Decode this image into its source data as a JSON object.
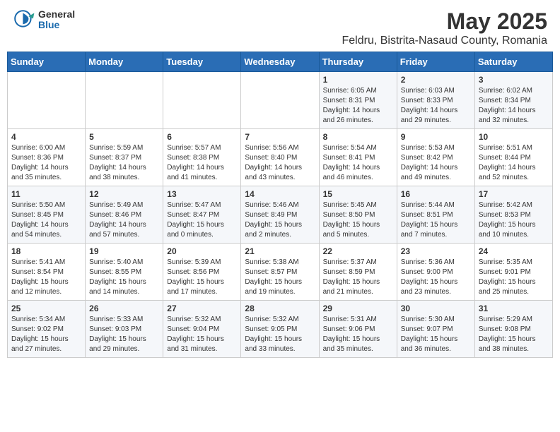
{
  "header": {
    "logo_general": "General",
    "logo_blue": "Blue",
    "title": "May 2025",
    "subtitle": "Feldru, Bistrita-Nasaud County, Romania"
  },
  "weekdays": [
    "Sunday",
    "Monday",
    "Tuesday",
    "Wednesday",
    "Thursday",
    "Friday",
    "Saturday"
  ],
  "weeks": [
    [
      {
        "day": "",
        "info": ""
      },
      {
        "day": "",
        "info": ""
      },
      {
        "day": "",
        "info": ""
      },
      {
        "day": "",
        "info": ""
      },
      {
        "day": "1",
        "info": "Sunrise: 6:05 AM\nSunset: 8:31 PM\nDaylight: 14 hours and 26 minutes."
      },
      {
        "day": "2",
        "info": "Sunrise: 6:03 AM\nSunset: 8:33 PM\nDaylight: 14 hours and 29 minutes."
      },
      {
        "day": "3",
        "info": "Sunrise: 6:02 AM\nSunset: 8:34 PM\nDaylight: 14 hours and 32 minutes."
      }
    ],
    [
      {
        "day": "4",
        "info": "Sunrise: 6:00 AM\nSunset: 8:36 PM\nDaylight: 14 hours and 35 minutes."
      },
      {
        "day": "5",
        "info": "Sunrise: 5:59 AM\nSunset: 8:37 PM\nDaylight: 14 hours and 38 minutes."
      },
      {
        "day": "6",
        "info": "Sunrise: 5:57 AM\nSunset: 8:38 PM\nDaylight: 14 hours and 41 minutes."
      },
      {
        "day": "7",
        "info": "Sunrise: 5:56 AM\nSunset: 8:40 PM\nDaylight: 14 hours and 43 minutes."
      },
      {
        "day": "8",
        "info": "Sunrise: 5:54 AM\nSunset: 8:41 PM\nDaylight: 14 hours and 46 minutes."
      },
      {
        "day": "9",
        "info": "Sunrise: 5:53 AM\nSunset: 8:42 PM\nDaylight: 14 hours and 49 minutes."
      },
      {
        "day": "10",
        "info": "Sunrise: 5:51 AM\nSunset: 8:44 PM\nDaylight: 14 hours and 52 minutes."
      }
    ],
    [
      {
        "day": "11",
        "info": "Sunrise: 5:50 AM\nSunset: 8:45 PM\nDaylight: 14 hours and 54 minutes."
      },
      {
        "day": "12",
        "info": "Sunrise: 5:49 AM\nSunset: 8:46 PM\nDaylight: 14 hours and 57 minutes."
      },
      {
        "day": "13",
        "info": "Sunrise: 5:47 AM\nSunset: 8:47 PM\nDaylight: 15 hours and 0 minutes."
      },
      {
        "day": "14",
        "info": "Sunrise: 5:46 AM\nSunset: 8:49 PM\nDaylight: 15 hours and 2 minutes."
      },
      {
        "day": "15",
        "info": "Sunrise: 5:45 AM\nSunset: 8:50 PM\nDaylight: 15 hours and 5 minutes."
      },
      {
        "day": "16",
        "info": "Sunrise: 5:44 AM\nSunset: 8:51 PM\nDaylight: 15 hours and 7 minutes."
      },
      {
        "day": "17",
        "info": "Sunrise: 5:42 AM\nSunset: 8:53 PM\nDaylight: 15 hours and 10 minutes."
      }
    ],
    [
      {
        "day": "18",
        "info": "Sunrise: 5:41 AM\nSunset: 8:54 PM\nDaylight: 15 hours and 12 minutes."
      },
      {
        "day": "19",
        "info": "Sunrise: 5:40 AM\nSunset: 8:55 PM\nDaylight: 15 hours and 14 minutes."
      },
      {
        "day": "20",
        "info": "Sunrise: 5:39 AM\nSunset: 8:56 PM\nDaylight: 15 hours and 17 minutes."
      },
      {
        "day": "21",
        "info": "Sunrise: 5:38 AM\nSunset: 8:57 PM\nDaylight: 15 hours and 19 minutes."
      },
      {
        "day": "22",
        "info": "Sunrise: 5:37 AM\nSunset: 8:59 PM\nDaylight: 15 hours and 21 minutes."
      },
      {
        "day": "23",
        "info": "Sunrise: 5:36 AM\nSunset: 9:00 PM\nDaylight: 15 hours and 23 minutes."
      },
      {
        "day": "24",
        "info": "Sunrise: 5:35 AM\nSunset: 9:01 PM\nDaylight: 15 hours and 25 minutes."
      }
    ],
    [
      {
        "day": "25",
        "info": "Sunrise: 5:34 AM\nSunset: 9:02 PM\nDaylight: 15 hours and 27 minutes."
      },
      {
        "day": "26",
        "info": "Sunrise: 5:33 AM\nSunset: 9:03 PM\nDaylight: 15 hours and 29 minutes."
      },
      {
        "day": "27",
        "info": "Sunrise: 5:32 AM\nSunset: 9:04 PM\nDaylight: 15 hours and 31 minutes."
      },
      {
        "day": "28",
        "info": "Sunrise: 5:32 AM\nSunset: 9:05 PM\nDaylight: 15 hours and 33 minutes."
      },
      {
        "day": "29",
        "info": "Sunrise: 5:31 AM\nSunset: 9:06 PM\nDaylight: 15 hours and 35 minutes."
      },
      {
        "day": "30",
        "info": "Sunrise: 5:30 AM\nSunset: 9:07 PM\nDaylight: 15 hours and 36 minutes."
      },
      {
        "day": "31",
        "info": "Sunrise: 5:29 AM\nSunset: 9:08 PM\nDaylight: 15 hours and 38 minutes."
      }
    ]
  ]
}
